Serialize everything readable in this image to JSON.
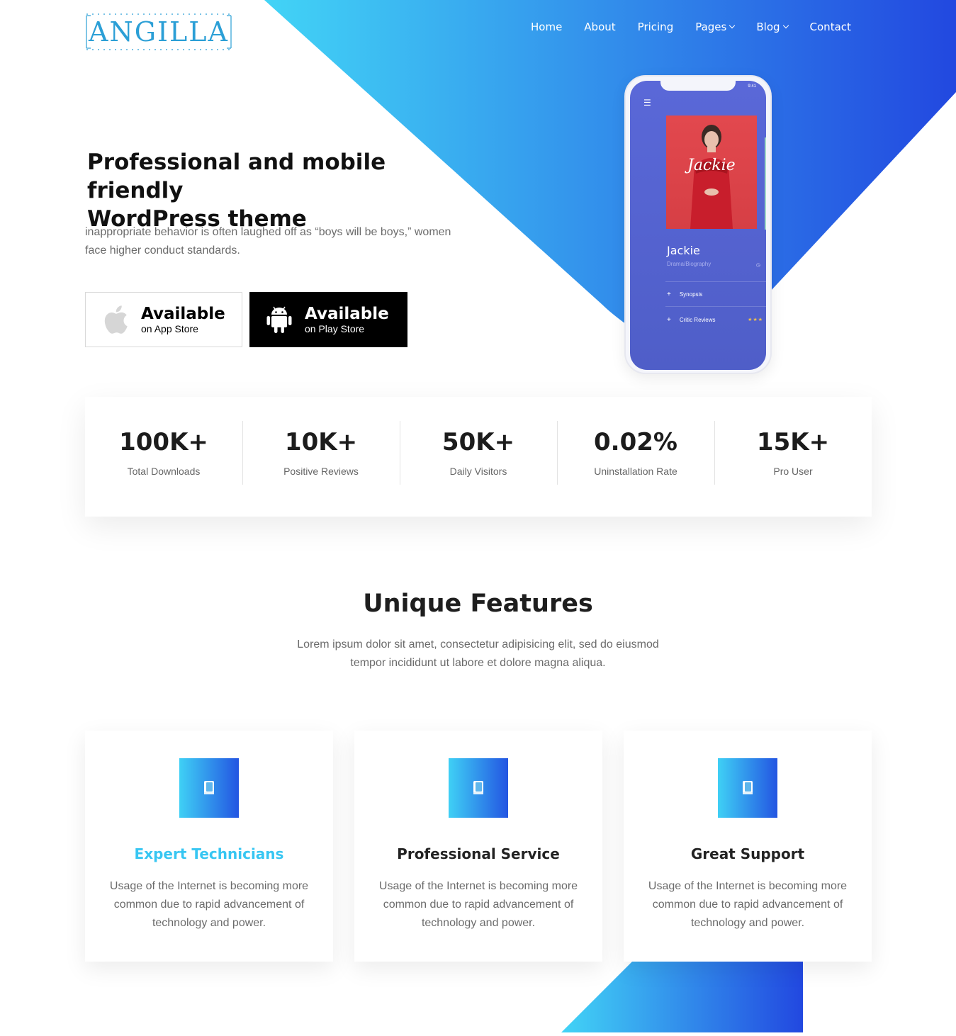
{
  "brand": {
    "logo_text": "ANGILLA"
  },
  "colors": {
    "gradient_start": "#42d4f6",
    "gradient_end": "#2248e0",
    "accent": "#37c6f2",
    "phone_screen": "#5a68d8"
  },
  "nav": {
    "items": [
      {
        "label": "Home",
        "has_dropdown": false
      },
      {
        "label": "About",
        "has_dropdown": false
      },
      {
        "label": "Pricing",
        "has_dropdown": false
      },
      {
        "label": "Pages",
        "has_dropdown": true
      },
      {
        "label": "Blog",
        "has_dropdown": true
      },
      {
        "label": "Contact",
        "has_dropdown": false
      }
    ]
  },
  "hero": {
    "title_line1": "Professional and mobile friendly",
    "title_line2": "WordPress theme",
    "description_line1": "inappropriate behavior is often laughed off as “boys will be boys,” women",
    "description_line2": "face higher conduct standards.",
    "app_store": {
      "main": "Available",
      "sub": "on App Store",
      "icon": "apple-icon"
    },
    "play_store": {
      "main": "Available",
      "sub": "on Play Store",
      "icon": "android-icon"
    }
  },
  "phone": {
    "time": "9:41",
    "movie_title": "Jackie",
    "genre": "Drama/Biography",
    "poster_script": "Jackie",
    "rows": [
      "Synopsis",
      "Critic Reviews"
    ],
    "stars": "★★★"
  },
  "stats": [
    {
      "value": "100K+",
      "label": "Total Downloads"
    },
    {
      "value": "10K+",
      "label": "Positive Reviews"
    },
    {
      "value": "50K+",
      "label": "Daily Visitors"
    },
    {
      "value": "0.02%",
      "label": "Uninstallation Rate"
    },
    {
      "value": "15K+",
      "label": "Pro User"
    }
  ],
  "features": {
    "title": "Unique Features",
    "description_line1": "Lorem ipsum dolor sit amet, consectetur adipisicing elit, sed do eiusmod",
    "description_line2": "tempor incididunt ut labore et dolore magna aliqua.",
    "cards": [
      {
        "title": "Expert Technicians",
        "text_line1": "Usage of the Internet is becoming more",
        "text_line2": "common due to rapid advancement of",
        "text_line3": "technology and power.",
        "icon": "book-icon"
      },
      {
        "title": "Professional Service",
        "text_line1": "Usage of the Internet is becoming more",
        "text_line2": "common due to rapid advancement of",
        "text_line3": "technology and power.",
        "icon": "book-icon"
      },
      {
        "title": "Great Support",
        "text_line1": "Usage of the Internet is becoming more",
        "text_line2": "common due to rapid advancement of",
        "text_line3": "technology and power.",
        "icon": "book-icon"
      }
    ]
  }
}
